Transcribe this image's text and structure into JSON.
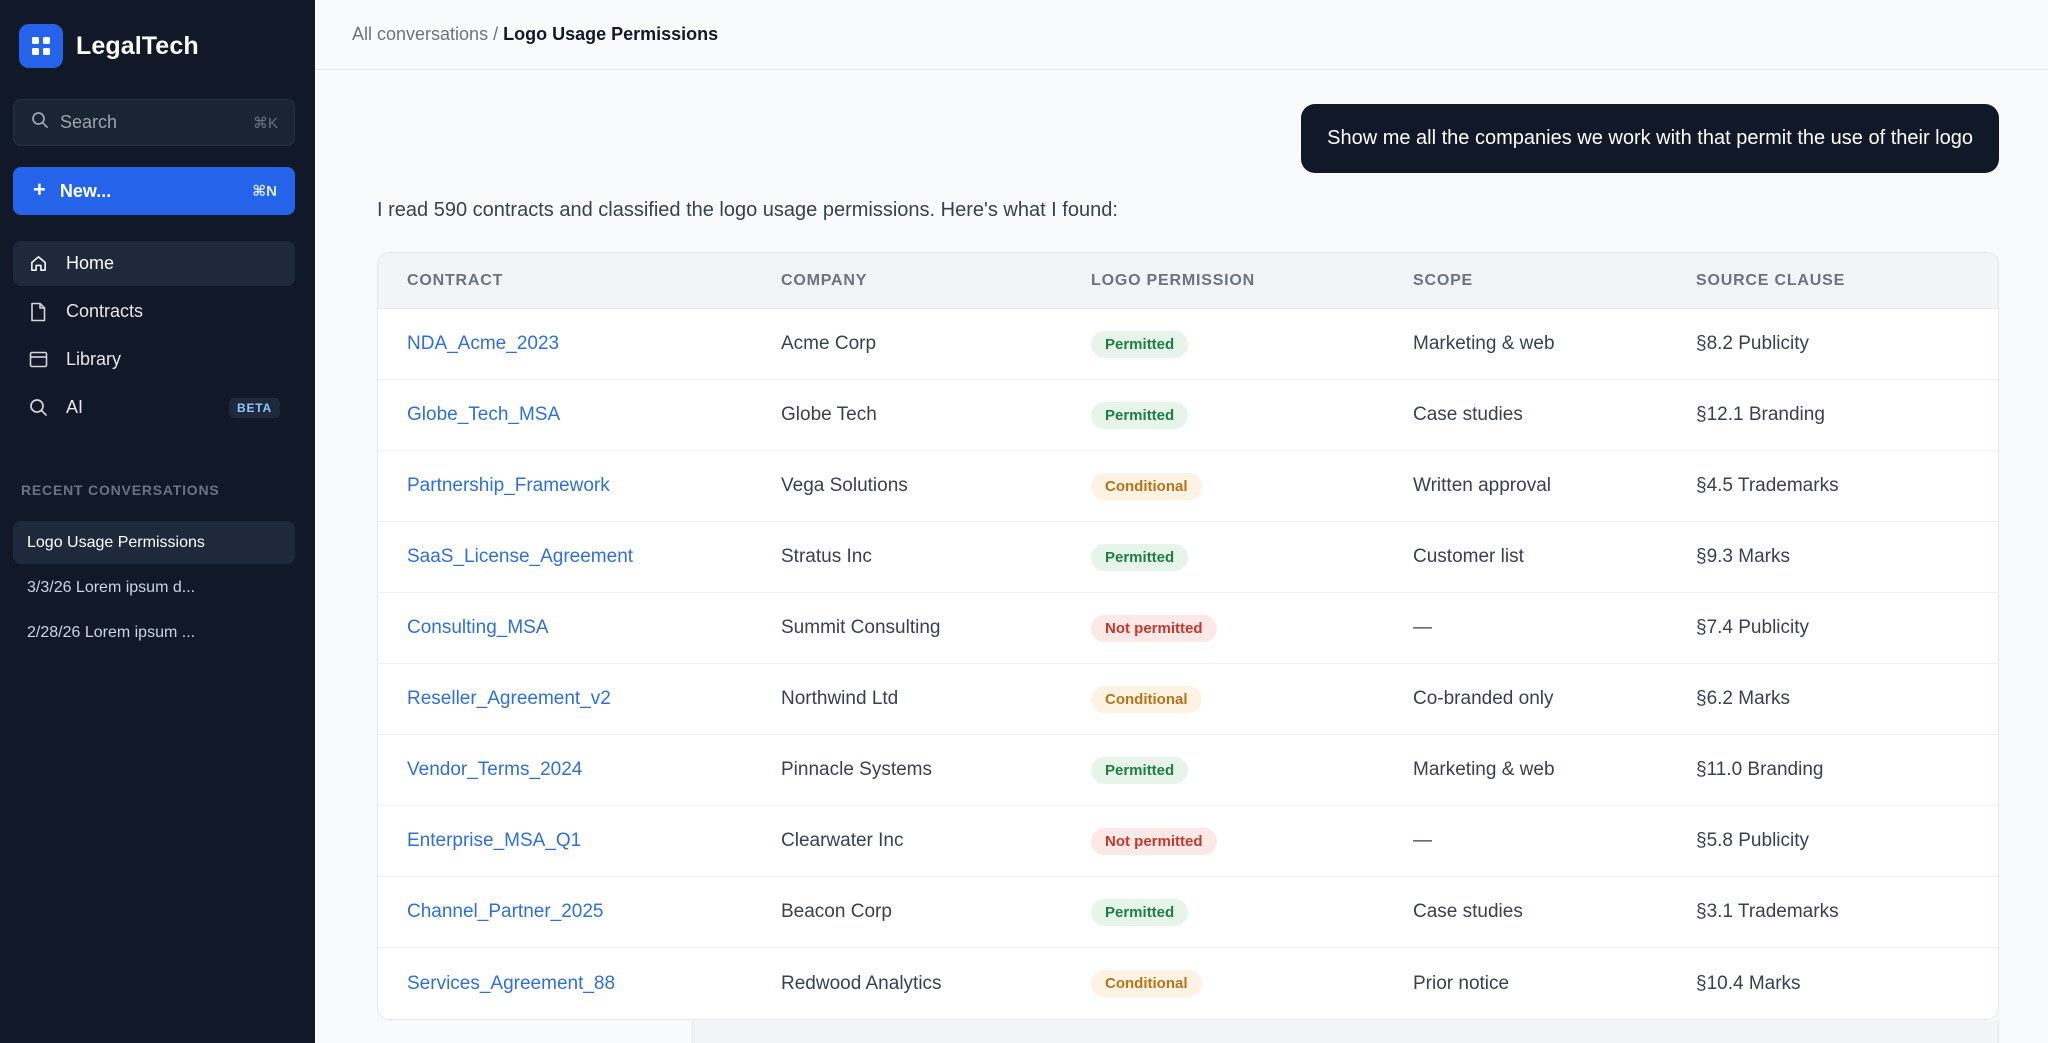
{
  "app": {
    "name": "LegalTech"
  },
  "sidebar": {
    "search_placeholder": "Search",
    "search_shortcut": "⌘K",
    "new_label": "New...",
    "new_shortcut": "⌘N",
    "nav": [
      {
        "label": "Home",
        "icon": "home-icon",
        "active": true
      },
      {
        "label": "Contracts",
        "icon": "document-icon"
      },
      {
        "label": "Library",
        "icon": "library-icon"
      },
      {
        "label": "AI",
        "icon": "search-icon",
        "badge": "BETA"
      }
    ],
    "recent_title": "RECENT CONVERSATIONS",
    "recent": [
      {
        "label": "Logo Usage Permissions",
        "active": true
      },
      {
        "label": "3/3/26 Lorem ipsum d..."
      },
      {
        "label": "2/28/26 Lorem ipsum ..."
      }
    ]
  },
  "breadcrumb": {
    "parent": "All conversations",
    "separator": "/",
    "current": "Logo Usage Permissions"
  },
  "chat": {
    "user_message": "Show me all the companies we work with that permit the use of their logo",
    "assistant_intro": "I read 590 contracts and classified the logo usage permissions. Here's what I found:"
  },
  "table": {
    "columns": [
      "CONTRACT",
      "COMPANY",
      "LOGO PERMISSION",
      "SCOPE",
      "SOURCE CLAUSE"
    ],
    "rows": [
      {
        "contract": "NDA_Acme_2023",
        "company": "Acme Corp",
        "permission": "Permitted",
        "scope": "Marketing & web",
        "clause": "§8.2 Publicity"
      },
      {
        "contract": "Globe_Tech_MSA",
        "company": "Globe Tech",
        "permission": "Permitted",
        "scope": "Case studies",
        "clause": "§12.1 Branding"
      },
      {
        "contract": "Partnership_Framework",
        "company": "Vega Solutions",
        "permission": "Conditional",
        "scope": "Written approval",
        "clause": "§4.5 Trademarks"
      },
      {
        "contract": "SaaS_License_Agreement",
        "company": "Stratus Inc",
        "permission": "Permitted",
        "scope": "Customer list",
        "clause": "§9.3 Marks"
      },
      {
        "contract": "Consulting_MSA",
        "company": "Summit Consulting",
        "permission": "Not permitted",
        "scope": "—",
        "clause": "§7.4 Publicity"
      },
      {
        "contract": "Reseller_Agreement_v2",
        "company": "Northwind Ltd",
        "permission": "Conditional",
        "scope": "Co-branded only",
        "clause": "§6.2 Marks"
      },
      {
        "contract": "Vendor_Terms_2024",
        "company": "Pinnacle Systems",
        "permission": "Permitted",
        "scope": "Marketing & web",
        "clause": "§11.0 Branding"
      },
      {
        "contract": "Enterprise_MSA_Q1",
        "company": "Clearwater Inc",
        "permission": "Not permitted",
        "scope": "—",
        "clause": "§5.8 Publicity"
      },
      {
        "contract": "Channel_Partner_2025",
        "company": "Beacon Corp",
        "permission": "Permitted",
        "scope": "Case studies",
        "clause": "§3.1 Trademarks"
      },
      {
        "contract": "Services_Agreement_88",
        "company": "Redwood Analytics",
        "permission": "Conditional",
        "scope": "Prior notice",
        "clause": "§10.4 Marks"
      }
    ]
  },
  "colors": {
    "sidebar_bg": "#111827",
    "accent": "#2563eb",
    "link": "#2f6fd6",
    "permitted": "#1e7e45",
    "conditional": "#b6741a",
    "not_permitted": "#c0392b"
  }
}
